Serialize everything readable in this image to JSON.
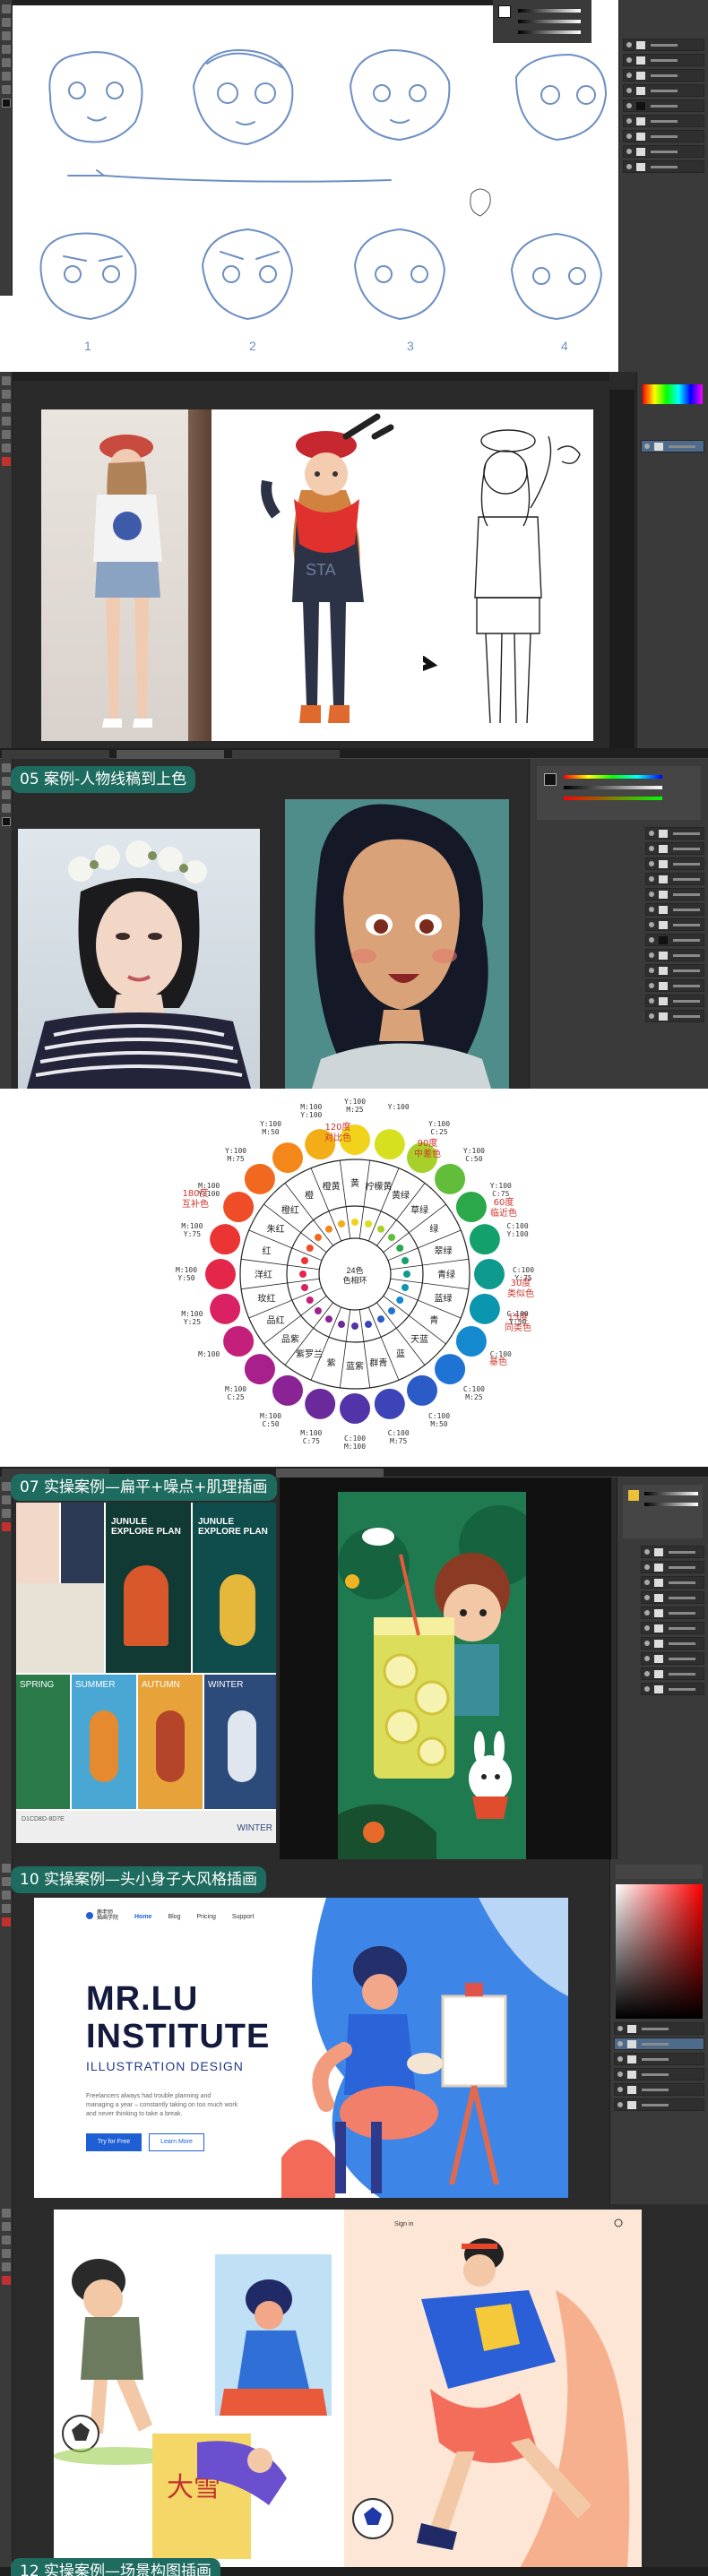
{
  "sections": {
    "case05": "05 案例-人物线稿到上色",
    "case07": "07 实操案例—扁平+噪点+肌理插画",
    "case10": "10 实操案例—头小身子大风格插画",
    "case12": "12 实操案例—场景构图插画"
  },
  "sketch": {
    "numbers": [
      "1",
      "2",
      "3",
      "4"
    ]
  },
  "girl_sweater_text": "STA",
  "color_wheel": {
    "angle_labels": [
      {
        "deg": "120度",
        "name": "对比色"
      },
      {
        "deg": "90度",
        "name": "中差色"
      },
      {
        "deg": "60度",
        "name": "临近色"
      },
      {
        "deg": "30度",
        "name": "类似色"
      },
      {
        "deg": "15度",
        "name": "同类色"
      },
      {
        "deg": "",
        "name": "基色"
      },
      {
        "deg": "180度",
        "name": "互补色"
      }
    ],
    "center_text": [
      "24色",
      "色相环"
    ],
    "swatch_colors": [
      "#f2d31b",
      "#d7e01f",
      "#a7d02b",
      "#62bd3a",
      "#2aa84a",
      "#13a06b",
      "#0e9b8e",
      "#0b96b0",
      "#1489cf",
      "#1f73d4",
      "#2a5bc6",
      "#3c44b7",
      "#5234a8",
      "#6b2a9c",
      "#8a2394",
      "#a7208b",
      "#c41f7a",
      "#d92163",
      "#e4264a",
      "#ea3534",
      "#ee4d27",
      "#f0691f",
      "#f3871a",
      "#f3ad17"
    ],
    "ring_names": [
      "黄",
      "柠檬黄",
      "黄绿",
      "草绿",
      "绿",
      "翠绿",
      "青绿",
      "蓝绿",
      "青",
      "天蓝",
      "蓝",
      "群青",
      "蓝紫",
      "紫",
      "紫罗兰",
      "品紫",
      "品红",
      "玫红",
      "洋红",
      "红",
      "朱红",
      "橙红",
      "橙",
      "橙黄"
    ],
    "cmy": [
      {
        "c": "Y:100",
        "m": "M:25"
      },
      {
        "c": "Y:100",
        "m": ""
      },
      {
        "c": "Y:100",
        "m": "C:25"
      },
      {
        "c": "Y:100",
        "m": "C:50"
      },
      {
        "c": "Y:100",
        "m": "C:75"
      },
      {
        "c": "C:100",
        "m": "Y:100"
      },
      {
        "c": "C:100",
        "m": "Y:75"
      },
      {
        "c": "C:100",
        "m": "Y:50"
      },
      {
        "c": "C:100",
        "m": ""
      },
      {
        "c": "C:100",
        "m": "M:25"
      },
      {
        "c": "C:100",
        "m": "M:50"
      },
      {
        "c": "C:100",
        "m": "M:75"
      },
      {
        "c": "C:100",
        "m": "M:100"
      },
      {
        "c": "M:100",
        "m": "C:75"
      },
      {
        "c": "M:100",
        "m": "C:50"
      },
      {
        "c": "M:100",
        "m": "C:25"
      },
      {
        "c": "M:100",
        "m": ""
      },
      {
        "c": "M:100",
        "m": "Y:25"
      },
      {
        "c": "M:100",
        "m": "Y:50"
      },
      {
        "c": "M:100",
        "m": "Y:75"
      },
      {
        "c": "M:100",
        "m": "Y:100"
      },
      {
        "c": "Y:100",
        "m": "M:75"
      },
      {
        "c": "Y:100",
        "m": "M:50"
      },
      {
        "c": "M:100",
        "m": "Y:100"
      }
    ]
  },
  "posters": {
    "p1": "JUNULE EXPLORE PLAN",
    "p2": "JUNULE EXPLORE PLAN",
    "spring": "SPRING",
    "summer": "SUMMER",
    "autumn": "AUTUMN",
    "winter": "WINTER",
    "winter2": "WINTER",
    "code": "D1CD8D·8D7E"
  },
  "site": {
    "logo_text": [
      "鹿老师",
      "插画学院"
    ],
    "nav": [
      "Home",
      "Blog",
      "Pricing",
      "Support"
    ],
    "title_line1": "MR.LU",
    "title_line2": "INSTITUTE",
    "subtitle": "ILLUSTRATION  DESIGN",
    "paragraph": "Freelancers always had trouble planning and managing a year – constantly taking on too much work and never thinking to take a break.",
    "btn_primary": "Try for Free",
    "btn_secondary": "Learn More"
  },
  "sport": {
    "nav_right": "Sign in",
    "poster_text": "大雪"
  }
}
